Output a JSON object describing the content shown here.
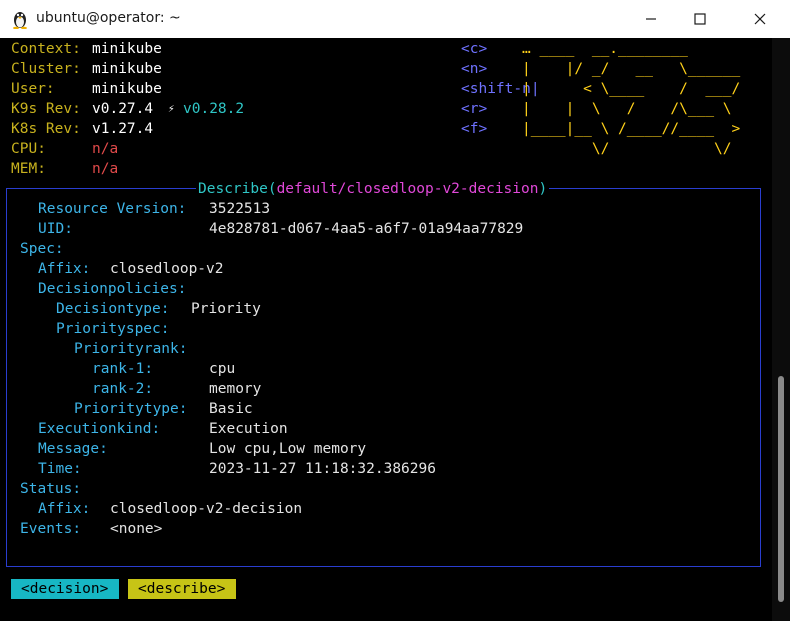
{
  "window": {
    "title": "ubuntu@operator: ~"
  },
  "header": {
    "rows": [
      {
        "label": "Context:",
        "value": "minikube",
        "value_color": "white"
      },
      {
        "label": "Cluster:",
        "value": "minikube",
        "value_color": "white"
      },
      {
        "label": "User:",
        "value": "minikube",
        "value_color": "white"
      },
      {
        "label": "K9s Rev:",
        "value": "v0.27.4",
        "upgrade": "v0.28.2",
        "value_color": "white"
      },
      {
        "label": "K8s Rev:",
        "value": "v1.27.4",
        "value_color": "white"
      },
      {
        "label": "CPU:",
        "value": "n/a",
        "value_color": "red"
      },
      {
        "label": "MEM:",
        "value": "n/a",
        "value_color": "red"
      }
    ],
    "hotkeys": [
      "<c>",
      "<n>",
      "<shift-n|",
      "<r>",
      "<f>"
    ],
    "logo_lines": [
      "… ____  __.________",
      "|    |/ _/   __   \\______",
      "|      < \\____    /  ___/",
      "|    |  \\   /    /\\___ \\",
      "|____|__ \\ /____//____  >",
      "        \\/            \\/"
    ]
  },
  "describe": {
    "title_prefix": "Describe(",
    "title_resource": "default/closedloop-v2-decision",
    "title_suffix": ")",
    "lines": [
      {
        "indent": 1,
        "key": "Resource Version:",
        "value": "3522513",
        "value_col": 209
      },
      {
        "indent": 1,
        "key": "UID:",
        "value": "4e828781-d067-4aa5-a6f7-01a94aa77829",
        "value_col": 209
      },
      {
        "indent": 0,
        "key": "Spec:",
        "value": ""
      },
      {
        "indent": 1,
        "key": "Affix:",
        "value": "closedloop-v2",
        "value_col": 110
      },
      {
        "indent": 1,
        "key": "Decisionpolicies:",
        "value": ""
      },
      {
        "indent": 2,
        "key": "Decisiontype:",
        "value": "Priority",
        "value_col": 191
      },
      {
        "indent": 2,
        "key": "Priorityspec:",
        "value": ""
      },
      {
        "indent": 3,
        "key": "Priorityrank:",
        "value": ""
      },
      {
        "indent": 4,
        "key": "rank-1:",
        "value": "cpu",
        "value_col": 209
      },
      {
        "indent": 4,
        "key": "rank-2:",
        "value": "memory",
        "value_col": 209
      },
      {
        "indent": 3,
        "key": "Prioritytype:",
        "value": "Basic",
        "value_col": 209
      },
      {
        "indent": 1,
        "key": "Executionkind:",
        "value": "Execution",
        "value_col": 209
      },
      {
        "indent": 1,
        "key": "Message:",
        "value": "Low cpu,Low memory",
        "value_col": 209
      },
      {
        "indent": 1,
        "key": "Time:",
        "value": "2023-11-27 11:18:32.386296",
        "value_col": 209
      },
      {
        "indent": 0,
        "key": "Status:",
        "value": ""
      },
      {
        "indent": 1,
        "key": "Affix:",
        "value": "closedloop-v2-decision",
        "value_col": 110
      },
      {
        "indent": 0,
        "key": "Events:",
        "value": "<none>",
        "value_col": 110
      }
    ]
  },
  "breadcrumbs": [
    {
      "label": "<decision>",
      "color": "#17b7c4"
    },
    {
      "label": "<describe>",
      "color": "#c7c416"
    }
  ]
}
